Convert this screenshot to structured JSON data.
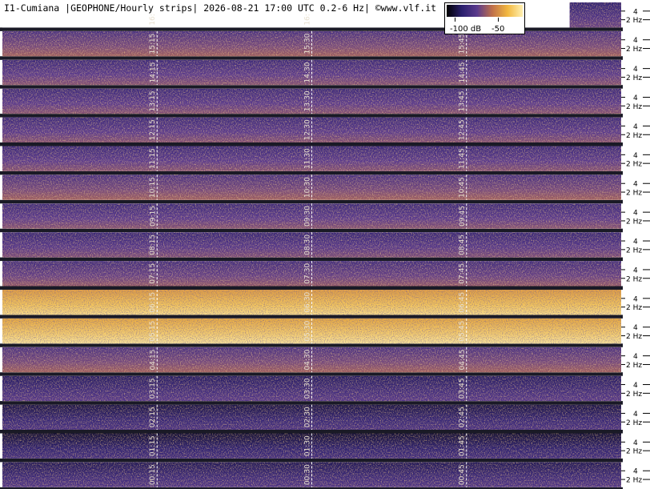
{
  "header": {
    "title": "I1-Cumiana |GEOPHONE/Hourly strips| 2026-08-21 17:00 UTC 0.2-6 Hz| ©www.vlf.it"
  },
  "colorbar": {
    "min_label": "-100 dB",
    "max_label": "-50",
    "colors": [
      "#000000",
      "#2a1f6e",
      "#5a3a8c",
      "#c0704a",
      "#f2b840",
      "#fff0b0"
    ]
  },
  "chart_data": {
    "type": "heatmap",
    "title": "I1-Cumiana |GEOPHONE/Hourly strips| 2026-08-21 17:00 UTC 0.2-6 Hz| ©www.vlf.it",
    "x_axis": "minutes within each hour strip",
    "strip_hours": [
      "16",
      "15",
      "14",
      "13",
      "12",
      "11",
      "10",
      "09",
      "08",
      "07",
      "06",
      "05",
      "04",
      "03",
      "02",
      "01",
      "00"
    ],
    "minute_ticks": [
      15,
      30,
      45
    ],
    "tick_labels": [
      [
        "16:15",
        "16:30",
        ""
      ],
      [
        "15:15",
        "15:30",
        "15:45"
      ],
      [
        "14:15",
        "14:30",
        "14:45"
      ],
      [
        "13:15",
        "13:30",
        "13:45"
      ],
      [
        "12:15",
        "12:30",
        "12:45"
      ],
      [
        "11:15",
        "11:30",
        "11:45"
      ],
      [
        "10:15",
        "10:30",
        "10:45"
      ],
      [
        "09:15",
        "09:30",
        "09:45"
      ],
      [
        "08:15",
        "08:30",
        "08:45"
      ],
      [
        "07:15",
        "07:30",
        "07:45"
      ],
      [
        "06:15",
        "06:30",
        "06:45"
      ],
      [
        "05:15",
        "05:30",
        "05:45"
      ],
      [
        "04:15",
        "04:30",
        "04:45"
      ],
      [
        "03:15",
        "03:30",
        "03:45"
      ],
      [
        "02:15",
        "02:30",
        "02:45"
      ],
      [
        "01:15",
        "01:30",
        "01:45"
      ],
      [
        "00:15",
        "00:30",
        "00:45"
      ]
    ],
    "strip_minutes_shown": [
      5,
      60,
      60,
      60,
      60,
      60,
      60,
      60,
      60,
      60,
      60,
      60,
      60,
      60,
      60,
      60,
      60
    ],
    "y_range_hz": [
      0.2,
      6
    ],
    "y_tick_labels": [
      "4",
      "2 Hz"
    ],
    "y_ticks_hz": [
      4,
      2
    ],
    "intensity_range_db": [
      -100,
      -50
    ],
    "strip_intensity": [
      0.35,
      0.45,
      0.4,
      0.4,
      0.4,
      0.4,
      0.45,
      0.4,
      0.38,
      0.42,
      0.85,
      0.88,
      0.45,
      0.3,
      0.25,
      0.22,
      0.28
    ]
  }
}
